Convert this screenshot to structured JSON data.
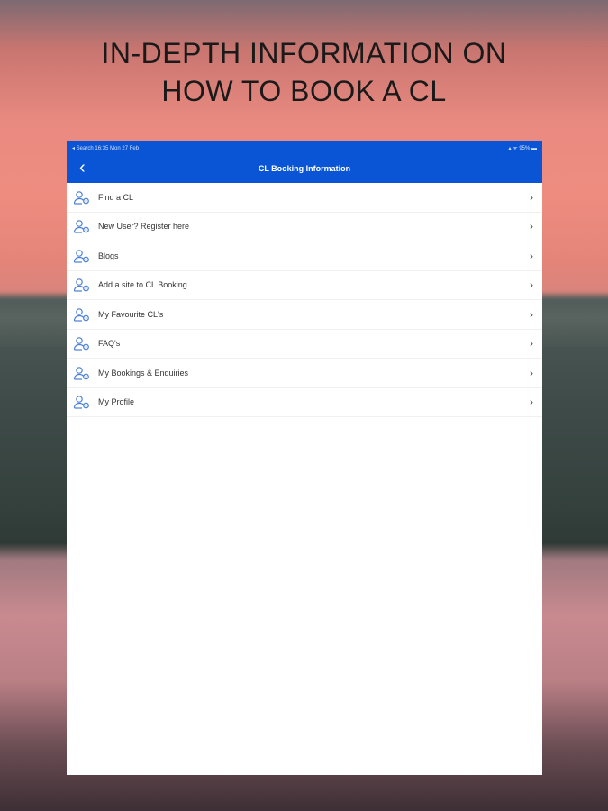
{
  "headline": {
    "line1": "IN-DEPTH INFORMATION ON",
    "line2": "HOW TO BOOK A CL"
  },
  "status_bar": {
    "left": "◂ Search  16:35  Mon 27 Feb",
    "right": "▴ ᯤ 95% ▬"
  },
  "header": {
    "title": "CL Booking Information",
    "back": "‹"
  },
  "menu": [
    {
      "label": "Find a CL"
    },
    {
      "label": "New User?  Register here"
    },
    {
      "label": "Blogs"
    },
    {
      "label": "Add a site to CL Booking"
    },
    {
      "label": "My Favourite CL's"
    },
    {
      "label": "FAQ's"
    },
    {
      "label": "My Bookings & Enquiries"
    },
    {
      "label": "My Profile"
    }
  ],
  "chevron": "›",
  "colors": {
    "accent": "#0a55d6",
    "icon": "#4a7fd6"
  }
}
